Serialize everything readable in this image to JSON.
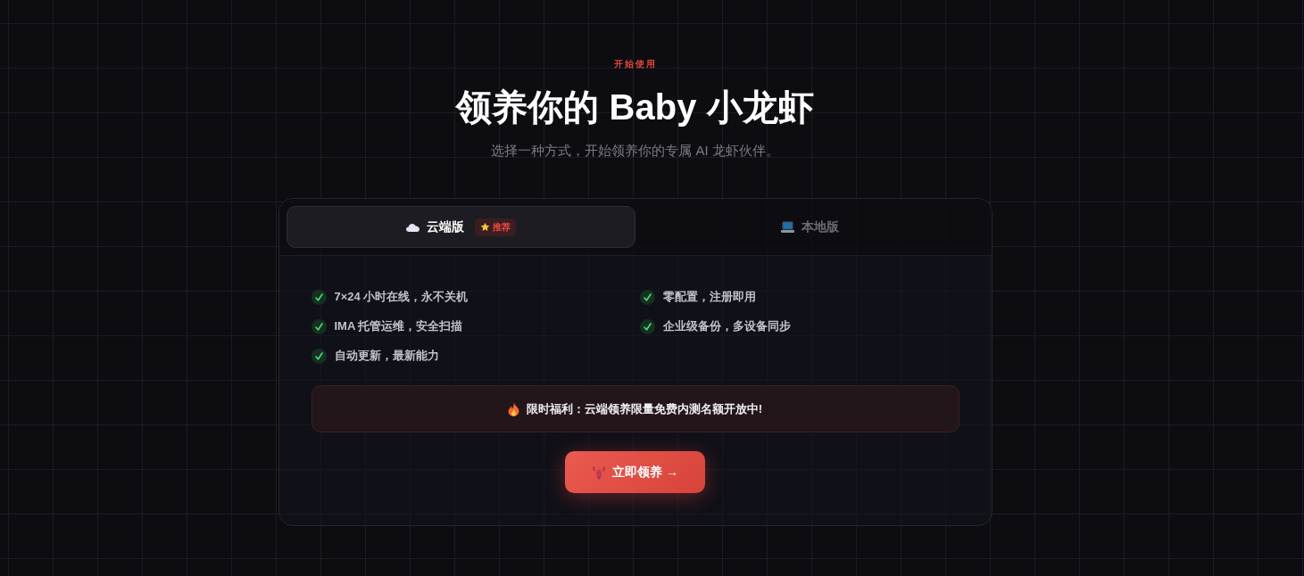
{
  "eyebrow": "开始使用",
  "title": "领养你的 Baby 小龙虾",
  "subtitle": "选择一种方式，开始领养你的专属 AI 龙虾伙伴。",
  "tabs": [
    {
      "kind": "cloud",
      "label": "云端版",
      "badge": "推荐",
      "selected": true
    },
    {
      "kind": "local",
      "label": "本地版",
      "selected": false
    }
  ],
  "features": [
    "7×24 小时在线，永不关机",
    "零配置，注册即用",
    "IMA 托管运维，安全扫描",
    "企业级备份，多设备同步",
    "自动更新，最新能力"
  ],
  "promo": "限时福利：云端领养限量免费内测名额开放中!",
  "cta": "立即领养 →"
}
